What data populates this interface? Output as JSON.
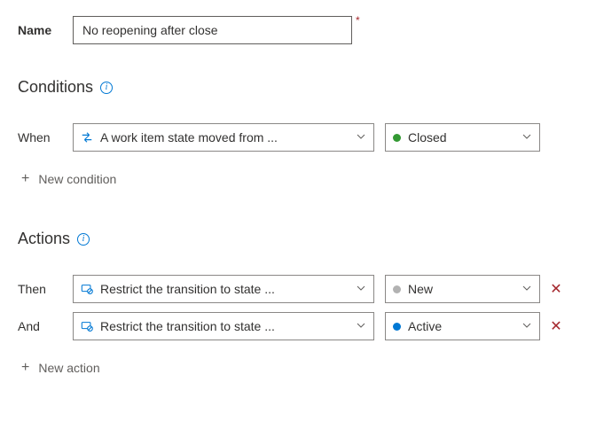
{
  "name": {
    "label": "Name",
    "value": "No reopening after close"
  },
  "conditions": {
    "heading": "Conditions",
    "rows": [
      {
        "prefix": "When",
        "type_label": "A work item state moved from ...",
        "icon": "transition",
        "state_label": "Closed",
        "state_color": "dot-closed",
        "deletable": false
      }
    ],
    "add_label": "New condition"
  },
  "actions": {
    "heading": "Actions",
    "rows": [
      {
        "prefix": "Then",
        "type_label": "Restrict the transition to state ...",
        "icon": "restrict",
        "state_label": "New",
        "state_color": "dot-new",
        "deletable": true
      },
      {
        "prefix": "And",
        "type_label": "Restrict the transition to state ...",
        "icon": "restrict",
        "state_label": "Active",
        "state_color": "dot-active",
        "deletable": true
      }
    ],
    "add_label": "New action"
  }
}
